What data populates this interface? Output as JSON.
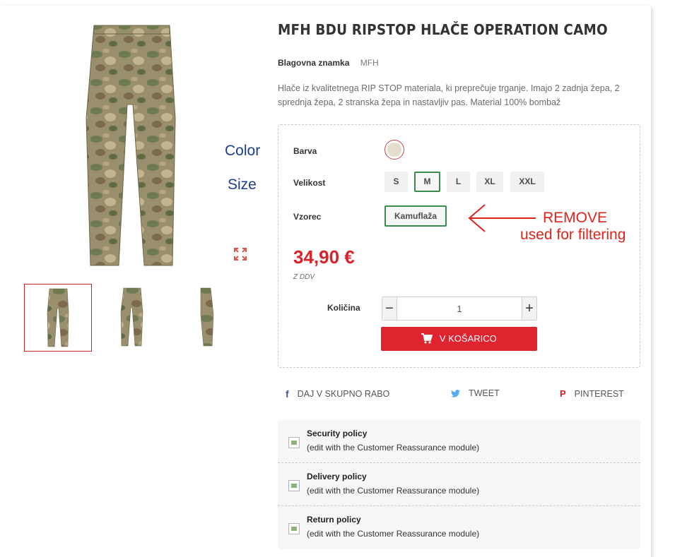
{
  "product": {
    "title": "MFH BDU RIPSTOP HLAČE OPERATION CAMO",
    "brand_label": "Blagovna znamka",
    "brand_value": "MFH",
    "description": "Hlače iz kvalitetnega RIP STOP materiala, ki preprečuje trganje. Imajo 2 zadnja žepa, 2 sprednja žepa, 2 stranska žepa in nastavljiv pas. Material 100% bombaž"
  },
  "gallery": {
    "main_image": "camo-pants-front",
    "expand_icon": "expand-icon",
    "thumbnails": [
      "camo-pants-front",
      "camo-pants-front-pockets",
      "camo-pants-side"
    ],
    "selected_index": 0
  },
  "variants": {
    "color_label": "Barva",
    "color_swatch": "#e6dccb",
    "size_label": "Velikost",
    "sizes": [
      "S",
      "M",
      "L",
      "XL",
      "XXL"
    ],
    "selected_size": "M",
    "pattern_label": "Vzorec",
    "pattern_value": "Kamuflaža"
  },
  "pricing": {
    "price": "34,90 €",
    "tax_note": "Z DDV"
  },
  "cart": {
    "quantity_label": "Količina",
    "quantity": "1",
    "minus": "−",
    "plus": "+",
    "add_to_cart": "V KOŠARICO"
  },
  "share": {
    "facebook": "DAJ V SKUPNO RABO",
    "twitter": "TWEET",
    "pinterest": "PINTEREST"
  },
  "reassurance": [
    {
      "title": "Security policy",
      "desc": "(edit with the Customer Reassurance module)"
    },
    {
      "title": "Delivery policy",
      "desc": "(edit with the Customer Reassurance module)"
    },
    {
      "title": "Return policy",
      "desc": "(edit with the Customer Reassurance module)"
    }
  ],
  "annotations": {
    "color": "Color",
    "size": "Size",
    "remove_line1": "REMOVE",
    "remove_line2": "used for filtering",
    "annotation_color": "#e0241c"
  }
}
